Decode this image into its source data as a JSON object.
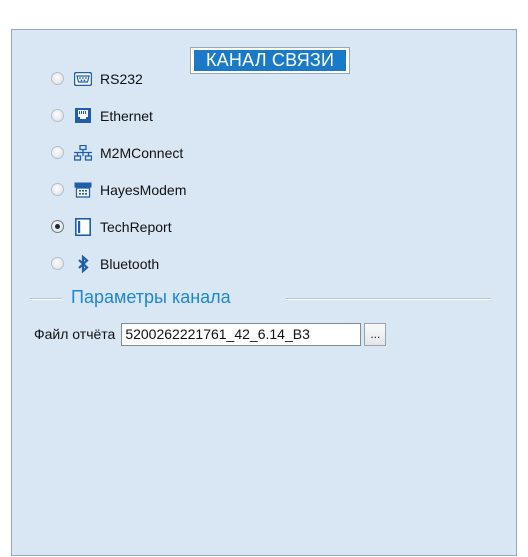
{
  "panel": {
    "title": "КАНАЛ СВЯЗИ"
  },
  "channels": [
    {
      "label": "RS232",
      "icon": "serial-port-icon",
      "checked": false
    },
    {
      "label": "Ethernet",
      "icon": "ethernet-port-icon",
      "checked": false
    },
    {
      "label": "M2MConnect",
      "icon": "m2m-network-icon",
      "checked": false
    },
    {
      "label": "HayesModem",
      "icon": "modem-icon",
      "checked": false
    },
    {
      "label": "TechReport",
      "icon": "document-icon",
      "checked": true
    },
    {
      "label": "Bluetooth",
      "icon": "bluetooth-icon",
      "checked": false
    }
  ],
  "params": {
    "title": "Параметры канала",
    "file_label": "Файл отчёта",
    "file_value": "5200262221761_42_6.14_B3",
    "browse_label": "..."
  },
  "colors": {
    "panel_bg": "#d9e7f5",
    "title_bg": "#1a7ac8",
    "group_title": "#1f86d4",
    "icon_blue": "#1f5fa8"
  }
}
